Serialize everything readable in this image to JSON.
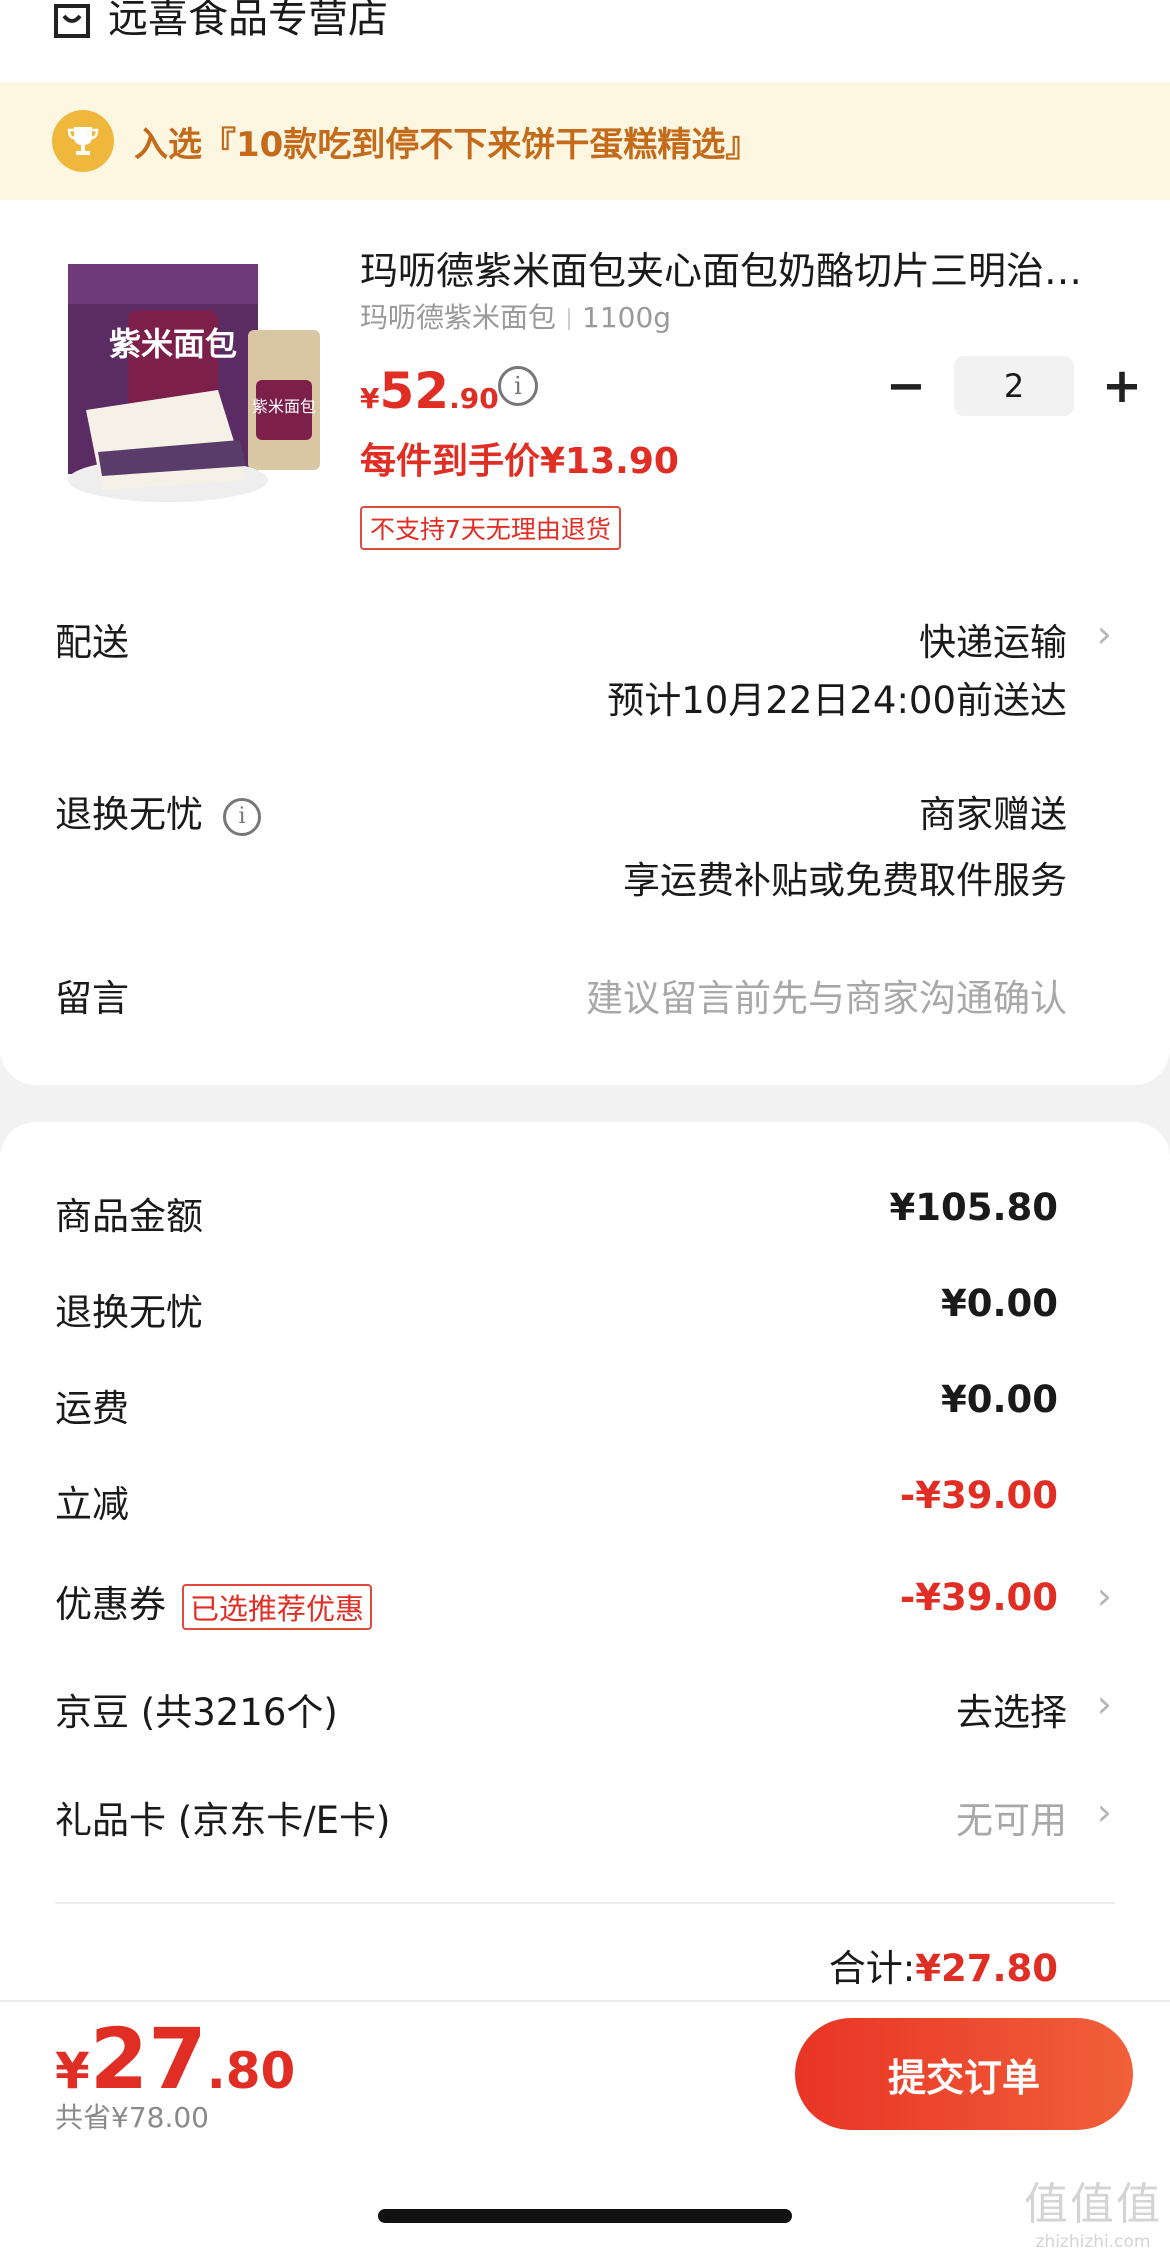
{
  "store": {
    "name": "远喜食品专营店"
  },
  "banner": {
    "text": "入选『10款吃到停不下来饼干蛋糕精选』"
  },
  "product": {
    "title": "玛呖德紫米面包夹心面包奶酪切片三明治…",
    "spec_name": "玛呖德紫米面包",
    "spec_weight": "1100g",
    "price_symbol": "¥",
    "price_int": "52",
    "price_dec": ".90",
    "quantity": "2",
    "unit_price": "每件到手价¥13.90",
    "return_tag": "不支持7天无理由退货",
    "image_text": "紫米面包",
    "image_text2": "紫米面包"
  },
  "delivery": {
    "label": "配送",
    "method": "快递运输",
    "eta": "预计10月22日24:00前送达"
  },
  "worry_free": {
    "label": "退换无忧",
    "value": "商家赠送",
    "detail": "享运费补贴或免费取件服务"
  },
  "message": {
    "label": "留言",
    "placeholder": "建议留言前先与商家沟通确认"
  },
  "summary": {
    "goods_amount_label": "商品金额",
    "goods_amount": "¥105.80",
    "worry_free_label": "退换无忧",
    "worry_free_amount": "¥0.00",
    "shipping_label": "运费",
    "shipping_amount": "¥0.00",
    "discount_label": "立减",
    "discount_amount": "-¥39.00",
    "coupon_label": "优惠券",
    "coupon_tag": "已选推荐优惠",
    "coupon_amount": "-¥39.00",
    "beans_label": "京豆 (共3216个)",
    "beans_action": "去选择",
    "giftcard_label": "礼品卡 (京东卡/E卡)",
    "giftcard_value": "无可用",
    "total_label": "合计:",
    "total_amount": "¥27.80"
  },
  "bottom": {
    "symbol": "¥",
    "int": "27",
    "dec": ".80",
    "saved": "共省¥78.00",
    "submit": "提交订单"
  },
  "watermark": {
    "logo": "值值值",
    "url": "zhizhizhi.com"
  },
  "colors": {
    "accent": "#e02e24",
    "banner_bg": "#fdf7e2",
    "banner_text": "#c46a1b"
  }
}
